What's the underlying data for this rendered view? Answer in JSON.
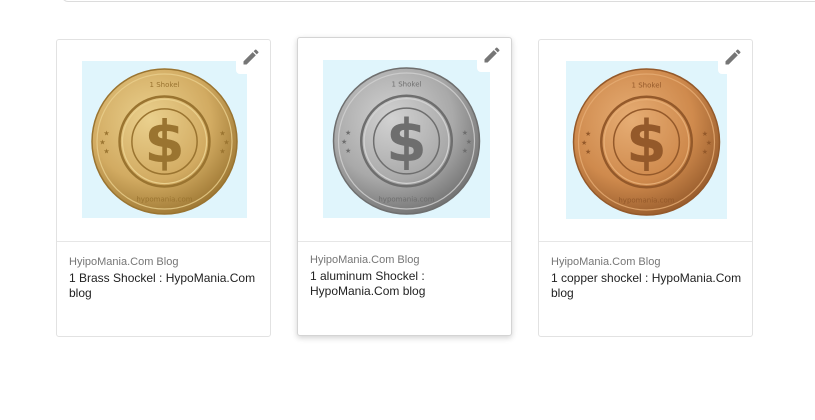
{
  "cards": [
    {
      "source": "HyipoMania.Com Blog",
      "title": "1 Brass Shockel : HypoMania.Com blog",
      "coin": {
        "top_text": "1 Shokel",
        "bottom_text": "hypomania.com",
        "symbol": "$",
        "colors": {
          "base": "#d2ab62",
          "light": "#ead08d",
          "dark": "#9a7430",
          "background": "#e0f5fc"
        }
      },
      "edit_icon": "pencil-icon"
    },
    {
      "source": "HyipoMania.Com Blog",
      "title": "1 aluminum Shockel : HypoMania.Com blog",
      "coin": {
        "top_text": "1 Shokel",
        "bottom_text": "hypomania.com",
        "symbol": "$",
        "colors": {
          "base": "#a9a9a9",
          "light": "#d2d2d2",
          "dark": "#6e6e6e",
          "background": "#e0f5fc"
        }
      },
      "edit_icon": "pencil-icon"
    },
    {
      "source": "HyipoMania.Com Blog",
      "title": "1 copper shockel : HypoMania.Com blog",
      "coin": {
        "top_text": "1 Shokel",
        "bottom_text": "hypomania.com",
        "symbol": "$",
        "colors": {
          "base": "#cf8a4d",
          "light": "#e6ad74",
          "dark": "#94592a",
          "background": "#e0f5fc"
        }
      },
      "edit_icon": "pencil-icon"
    }
  ]
}
